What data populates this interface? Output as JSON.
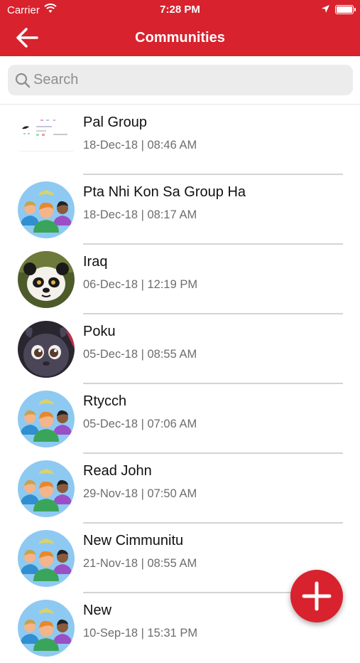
{
  "status_bar": {
    "carrier": "Carrier",
    "time": "7:28 PM",
    "battery_level": 1.0
  },
  "nav": {
    "title": "Communities",
    "back_icon": "arrow-left-icon"
  },
  "search": {
    "placeholder": "Search",
    "value": "",
    "icon": "search-icon"
  },
  "communities": [
    {
      "name": "Pal Group",
      "date": "18-Dec-18 | 08:46 AM",
      "avatar": "screenshot-thumbnail"
    },
    {
      "name": "Pta Nhi Kon Sa Group Ha",
      "date": "18-Dec-18 | 08:17 AM",
      "avatar": "group-people-icon"
    },
    {
      "name": "Iraq",
      "date": "06-Dec-18 | 12:19 PM",
      "avatar": "panda-photo"
    },
    {
      "name": "Poku",
      "date": "05-Dec-18 | 08:55 AM",
      "avatar": "creature-photo"
    },
    {
      "name": "Rtycch",
      "date": "05-Dec-18 | 07:06 AM",
      "avatar": "group-people-icon"
    },
    {
      "name": "Read John",
      "date": "29-Nov-18 | 07:50 AM",
      "avatar": "group-people-icon"
    },
    {
      "name": "New Cimmunitu",
      "date": "21-Nov-18 | 08:55 AM",
      "avatar": "group-people-icon"
    },
    {
      "name": "New",
      "date": "10-Sep-18 | 15:31 PM",
      "avatar": "group-people-icon"
    }
  ],
  "fab": {
    "icon": "plus-icon"
  },
  "colors": {
    "brand": "#d8222d",
    "avatar_bg": "#8ec9f2"
  }
}
